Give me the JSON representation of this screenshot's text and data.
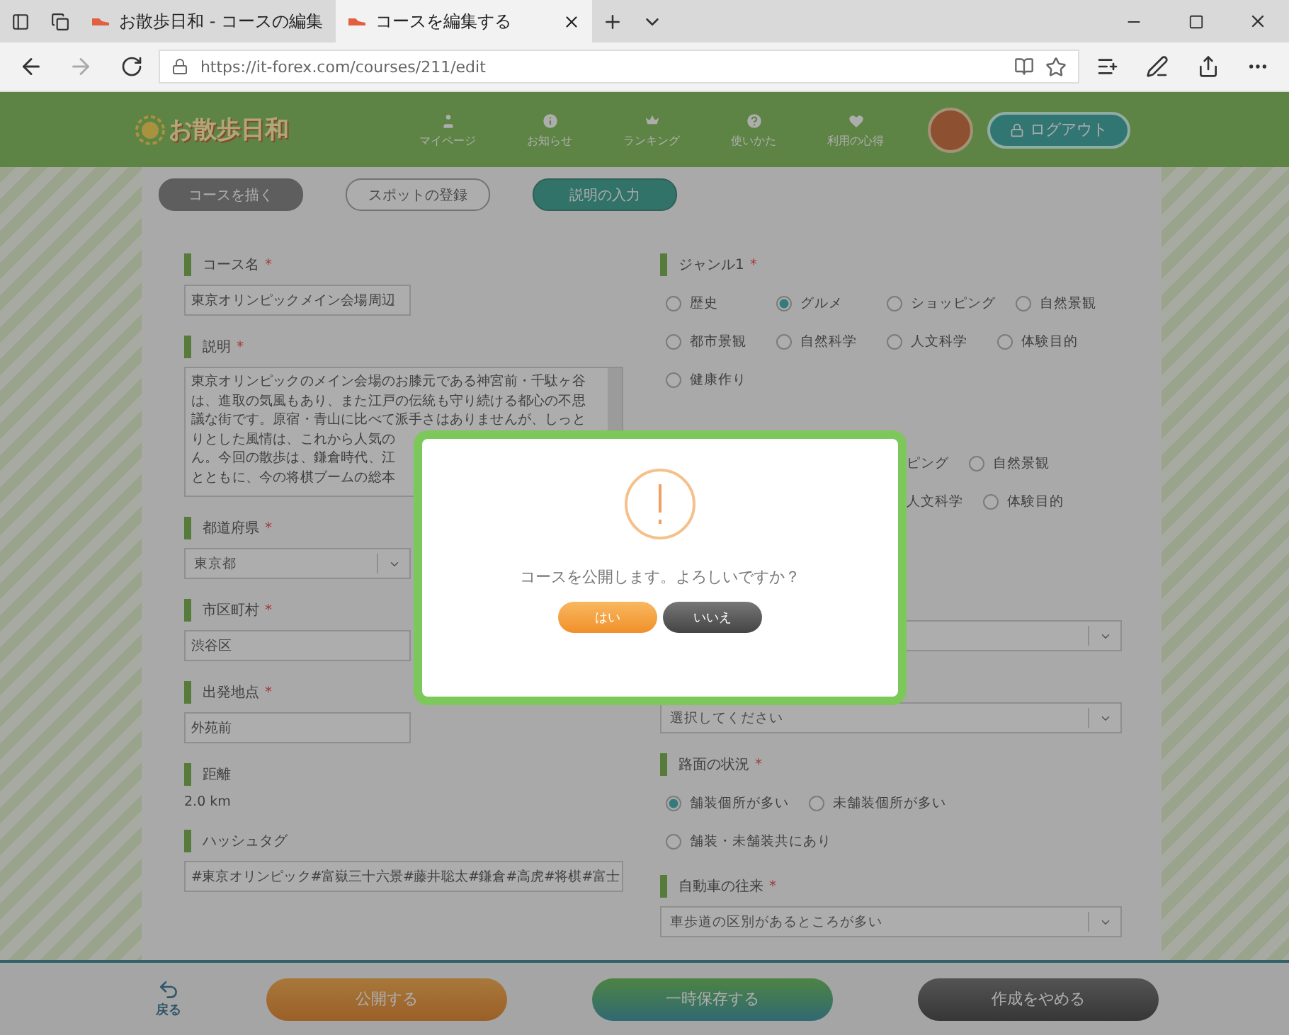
{
  "browser": {
    "tabs": [
      {
        "title": "お散歩日和 - コースの編集",
        "selected": false
      },
      {
        "title": "コースを編集する",
        "selected": true
      }
    ],
    "address": "https://it-forex.com/courses/211/edit"
  },
  "header": {
    "logo": "お散歩日和",
    "nav": [
      {
        "label": "マイページ"
      },
      {
        "label": "お知らせ"
      },
      {
        "label": "ランキング"
      },
      {
        "label": "使いかた"
      },
      {
        "label": "利用の心得"
      }
    ],
    "logout": "ログアウト"
  },
  "steps": [
    {
      "label": "コースを描く",
      "selected": false,
      "completed": true
    },
    {
      "label": "スポットの登録",
      "selected": false,
      "completed": false
    },
    {
      "label": "説明の入力",
      "selected": true,
      "completed": false
    }
  ],
  "left_fields": [
    {
      "kind": "input",
      "label": "コース名",
      "mark": "*",
      "value": "東京オリンピックメイン会場周辺"
    },
    {
      "kind": "textarea",
      "label": "説明",
      "mark": "*",
      "lines": [
        "東京オリンピックのメイン会場のお膝元である神宮前・千駄ヶ谷",
        "は、進取の気風もあり、また江戸の伝統も守り続ける都心の不思",
        "議な街です。原宿・青山に比べて派手さはありませんが、しっと",
        "りとした風情は、これから人気の",
        "ん。今回の散歩は、鎌倉時代、江",
        "とともに、今の将棋ブームの総本"
      ]
    },
    {
      "kind": "select",
      "label": "都道府県",
      "mark": "*",
      "value": "東京都"
    },
    {
      "kind": "input",
      "label": "市区町村",
      "mark": "*",
      "value": "渋谷区"
    },
    {
      "kind": "input",
      "label": "出発地点",
      "mark": "*",
      "value": "外苑前"
    },
    {
      "kind": "text",
      "label": "距離",
      "value": "2.0 km"
    },
    {
      "kind": "input",
      "label": "ハッシュタグ",
      "value": "#東京オリンピック#富嶽三十六景#藤井聡太#鎌倉#高虎#将棋#富士"
    }
  ],
  "right_fields": [
    {
      "kind": "radios",
      "label": "ジャンル1",
      "mark": "*",
      "rows": [
        [
          {
            "kind": "option",
            "label": "歴史",
            "selected": false
          },
          {
            "kind": "option",
            "label": "グルメ",
            "selected": true
          },
          {
            "kind": "option",
            "label": "ショッピング",
            "selected": false
          },
          {
            "kind": "option",
            "label": "自然景観",
            "selected": false
          }
        ],
        [
          {
            "kind": "option",
            "label": "都市景観",
            "selected": false
          },
          {
            "kind": "option",
            "label": "自然科学",
            "selected": false
          },
          {
            "kind": "option",
            "label": "人文科学",
            "selected": false
          },
          {
            "kind": "option",
            "label": "体験目的",
            "selected": false
          }
        ],
        [
          {
            "kind": "option",
            "label": "健康作り",
            "selected": false
          }
        ]
      ]
    },
    {
      "kind": "radios",
      "rows": [
        [
          {
            "kind": "fragment",
            "label": "ピング"
          },
          {
            "kind": "option",
            "label": "自然景観",
            "selected": false
          }
        ],
        [
          {
            "kind": "fragment",
            "label": "人文科学"
          },
          {
            "kind": "option",
            "label": "体験目的",
            "selected": false
          }
        ]
      ]
    },
    {
      "kind": "blank_select"
    },
    {
      "kind": "select",
      "value": "選択してください"
    },
    {
      "kind": "radios",
      "label": "路面の状況",
      "mark": "*",
      "rows": [
        [
          {
            "kind": "option",
            "label": "舗装個所が多い",
            "selected": true
          },
          {
            "kind": "option",
            "label": "未舗装個所が多い",
            "selected": false
          }
        ],
        [
          {
            "kind": "option",
            "label": "舗装・未舗装共にあり",
            "selected": false
          }
        ]
      ]
    },
    {
      "kind": "select",
      "label": "自動車の往来",
      "mark": "*",
      "value": "車歩道の区別があるところが多い"
    }
  ],
  "footer": {
    "back": "戻る",
    "buttons": [
      {
        "label": "公開する",
        "kind": "publish"
      },
      {
        "label": "一時保存する",
        "kind": "save"
      },
      {
        "label": "作成をやめる",
        "kind": "cancel"
      }
    ]
  },
  "dialog": {
    "message": "コースを公開します。よろしいですか？",
    "buttons": [
      {
        "label": "はい",
        "kind": "yes"
      },
      {
        "label": "いいえ",
        "kind": "no"
      }
    ]
  }
}
